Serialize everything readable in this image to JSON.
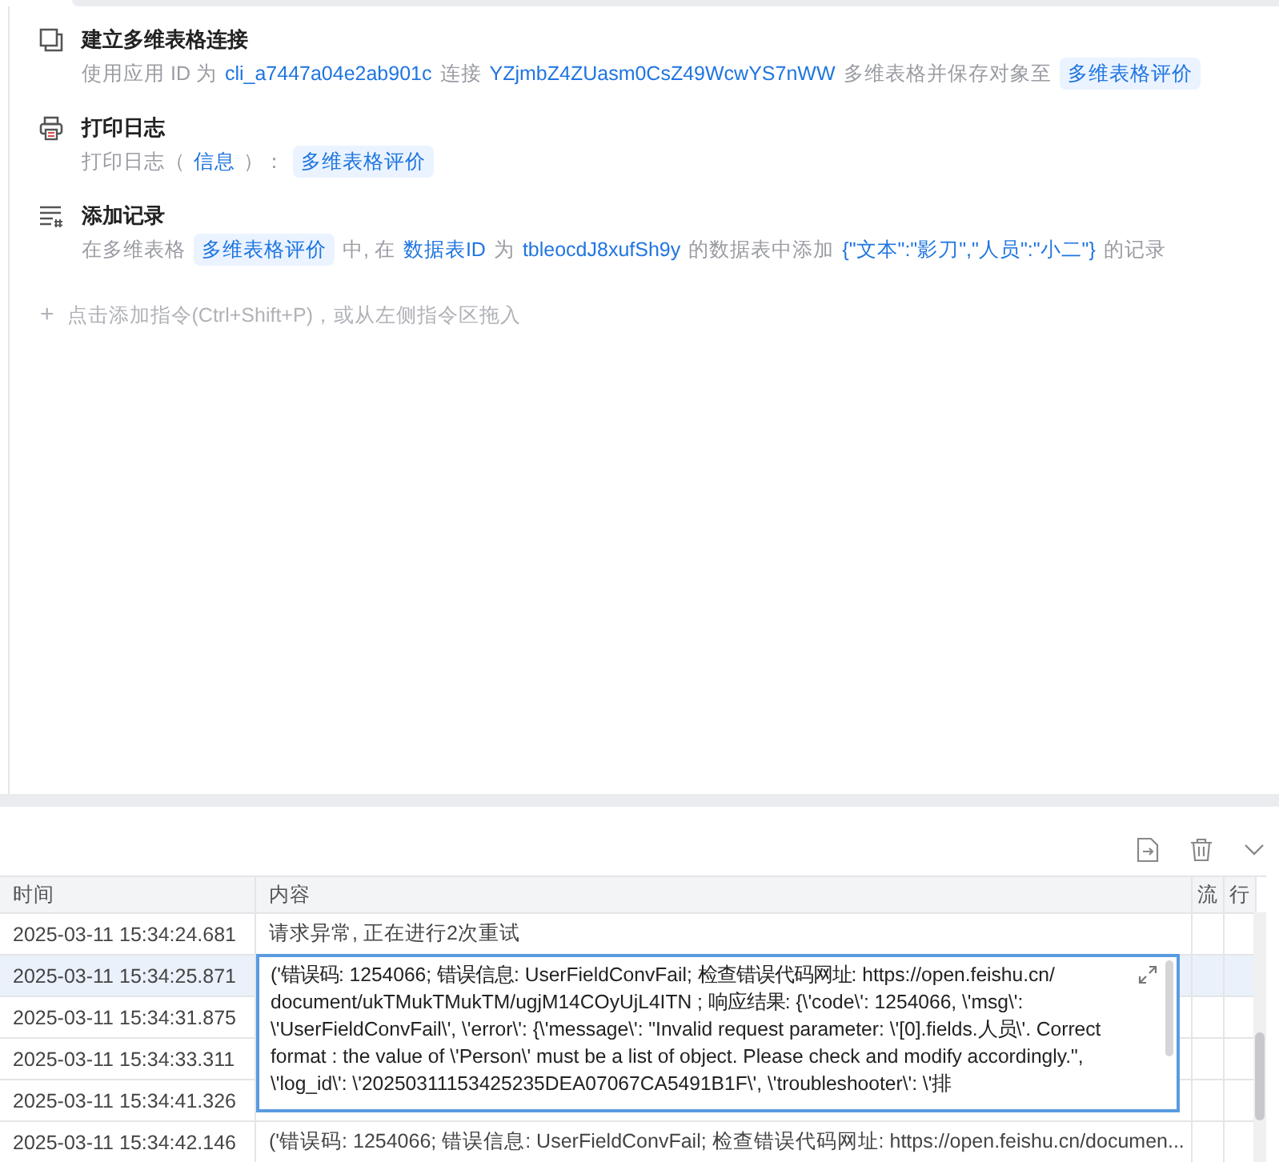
{
  "steps": [
    {
      "kind": "connect",
      "title": "建立多维表格连接",
      "parts": [
        {
          "kind": "text",
          "text": "使用应用 ID 为"
        },
        {
          "kind": "link",
          "text": "cli_a7447a04e2ab901c"
        },
        {
          "kind": "text",
          "text": "连接"
        },
        {
          "kind": "link",
          "text": "YZjmbZ4ZUasm0CsZ49WcwYS7nWW"
        },
        {
          "kind": "text",
          "text": "多维表格并保存对象至"
        },
        {
          "kind": "tag",
          "text": "多维表格评价"
        }
      ]
    },
    {
      "kind": "print",
      "title": "打印日志",
      "parts": [
        {
          "kind": "text",
          "text": "打印日志（"
        },
        {
          "kind": "link",
          "text": "信息"
        },
        {
          "kind": "text",
          "text": "）："
        },
        {
          "kind": "tag",
          "text": "多维表格评价"
        }
      ]
    },
    {
      "kind": "add_record",
      "title": "添加记录",
      "parts": [
        {
          "kind": "text",
          "text": "在多维表格"
        },
        {
          "kind": "tag",
          "text": "多维表格评价"
        },
        {
          "kind": "text",
          "text": "中, 在"
        },
        {
          "kind": "link",
          "text": "数据表ID"
        },
        {
          "kind": "text",
          "text": "为"
        },
        {
          "kind": "link",
          "text": "tbleocdJ8xufSh9y"
        },
        {
          "kind": "text",
          "text": "的数据表中添加"
        },
        {
          "kind": "link",
          "text": "{\"文本\":\"影刀\",\"人员\":\"小二\"}"
        },
        {
          "kind": "text",
          "text": "的记录"
        }
      ]
    }
  ],
  "add_hint": {
    "icon": "+",
    "text": "点击添加指令(Ctrl+Shift+P)，或从左侧指令区拖入"
  },
  "log": {
    "columns": [
      "时间",
      "内容",
      "流",
      "行"
    ],
    "rows": [
      {
        "time": "2025-03-11 15:34:24.681",
        "content": "请求异常, 正在进行2次重试",
        "selected": false
      },
      {
        "time": "2025-03-11 15:34:25.871",
        "selected": true
      },
      {
        "time": "2025-03-11 15:34:31.875",
        "selected": false
      },
      {
        "time": "2025-03-11 15:34:33.311",
        "selected": false
      },
      {
        "time": "2025-03-11 15:34:41.326",
        "selected": false
      },
      {
        "time": "2025-03-11 15:34:42.146",
        "content": "('错误码: 1254066; 错误信息: UserFieldConvFail; 检查错误代码网址: https://open.feishu.cn/documen...",
        "selected": false
      }
    ],
    "popup": {
      "text": "('错误码: 1254066; 错误信息: UserFieldConvFail; 检查错误代码网址: https://open.feishu.cn/ document/ukTMukTMukTM/ugjM14COyUjL4ITN ; 响应结果: {\\'code\\': 1254066, \\'msg\\': \\'UserFieldConvFail\\', \\'error\\': {\\'message\\': \"Invalid request parameter: \\'[0].fields.人员\\'. Correct format : the value of \\'Person\\' must be a list of object. Please check and modify accordingly.\", \\'log_id\\': \\'20250311153425235DEA07067CA5491B1F\\', \\'troubleshooter\\': \\'排"
    }
  }
}
